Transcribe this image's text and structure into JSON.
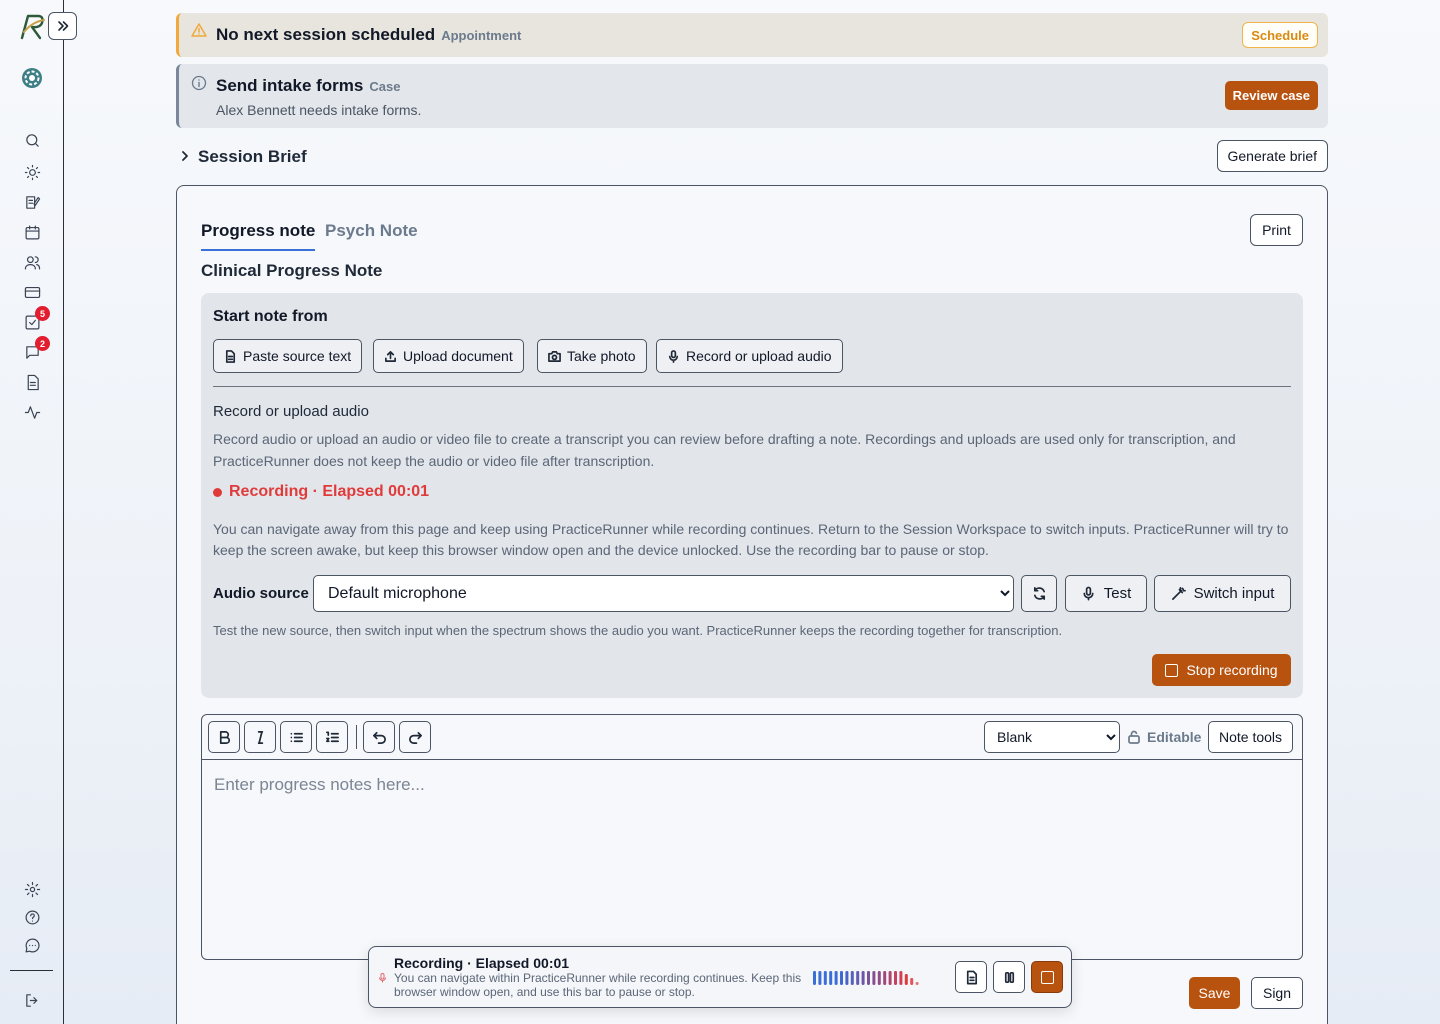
{
  "sidebar": {
    "expand_label": "»",
    "badges": {
      "tasks": "5",
      "messages": "2"
    }
  },
  "alerts": {
    "session": {
      "title": "No next session scheduled",
      "tag": "Appointment",
      "action": "Schedule"
    },
    "intake": {
      "title": "Send intake forms",
      "tag": "Case",
      "message": "Alex Bennett needs intake forms.",
      "action": "Review case"
    }
  },
  "brief": {
    "title": "Session Brief",
    "action": "Generate brief"
  },
  "note_card": {
    "tabs": [
      "Progress note",
      "Psych Note"
    ],
    "print_label": "Print",
    "heading": "Clinical Progress Note",
    "source": {
      "title": "Start note from",
      "chips": [
        "Paste source text",
        "Upload document",
        "Take photo",
        "Record or upload audio"
      ],
      "section_title": "Record or upload audio",
      "description": "Record audio or upload an audio or video file to create a transcript you can review before drafting a note. Recordings and uploads are used only for transcription, and PracticeRunner does not keep the audio or video file after transcription.",
      "recording_status": "Recording · Elapsed 00:01",
      "navigate_note": "You can navigate away from this page and keep using PracticeRunner while recording continues. Return to the Session Workspace to switch inputs. PracticeRunner will try to keep the screen awake, but keep this browser window open and the device unlocked. Use the recording bar to pause or stop.",
      "audio_label": "Audio source",
      "audio_selected": "Default microphone",
      "test_label": "Test",
      "switch_label": "Switch input",
      "hint": "Test the new source, then switch input when the spectrum shows the audio you want. PracticeRunner keeps the recording together for transcription.",
      "stop_label": "Stop recording"
    },
    "editor": {
      "template_selected": "Blank",
      "editable_label": "Editable",
      "tools_label": "Note tools",
      "placeholder": "Enter progress notes here..."
    },
    "save_label": "Save",
    "sign_label": "Sign"
  },
  "recording_bar": {
    "title": "Recording · Elapsed 00:01",
    "text": "You can navigate within PracticeRunner while recording continues. Keep this browser window open, and use this bar to pause or stop."
  },
  "colors": {
    "accent": "#b8520f",
    "recording": "#e03b3b",
    "tab_underline": "#3b6fd8",
    "warning": "#f0a93a"
  }
}
